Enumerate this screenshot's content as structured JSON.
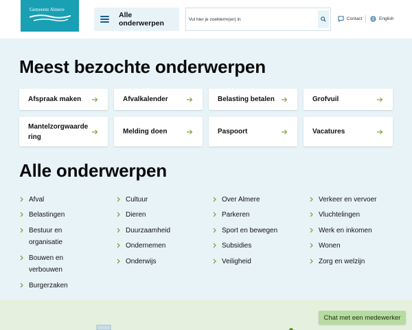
{
  "header": {
    "logo_text": "Gemeente Almere",
    "menu_label": "Alle onderwerpen",
    "search_placeholder": "Vul hier je zoekterm(en) in",
    "contact_label": "Contact",
    "language_label": "English"
  },
  "most_visited": {
    "title": "Meest bezochte onderwerpen",
    "items": [
      {
        "label": "Afspraak maken"
      },
      {
        "label": "Afvalkalender"
      },
      {
        "label": "Belasting betalen"
      },
      {
        "label": "Grofvuil"
      },
      {
        "label": "Mantelzorgwaardering"
      },
      {
        "label": "Melding doen"
      },
      {
        "label": "Paspoort"
      },
      {
        "label": "Vacatures"
      }
    ]
  },
  "all_topics": {
    "title": "Alle onderwerpen",
    "col1": [
      "Afval",
      "Belastingen",
      "Bestuur en organisatie",
      "Bouwen en verbouwen",
      "Burgerzaken"
    ],
    "col2": [
      "Cultuur",
      "Dieren",
      "Duurzaamheid",
      "Ondernemen",
      "Onderwijs"
    ],
    "col3": [
      "Over Almere",
      "Parkeren",
      "Sport en bewegen",
      "Subsidies",
      "Veiligheid"
    ],
    "col4": [
      "Verkeer en vervoer",
      "Vluchtelingen",
      "Werk en inkomen",
      "Wonen",
      "Zorg en welzijn"
    ]
  },
  "chat": {
    "label": "Chat met een medewerker"
  },
  "colors": {
    "logo": "#1aa0b5",
    "accent": "#1a5c8a",
    "arrow": "#7aa83a",
    "page_bg": "#e8f3f8",
    "chat_bg": "#b7dba0"
  }
}
